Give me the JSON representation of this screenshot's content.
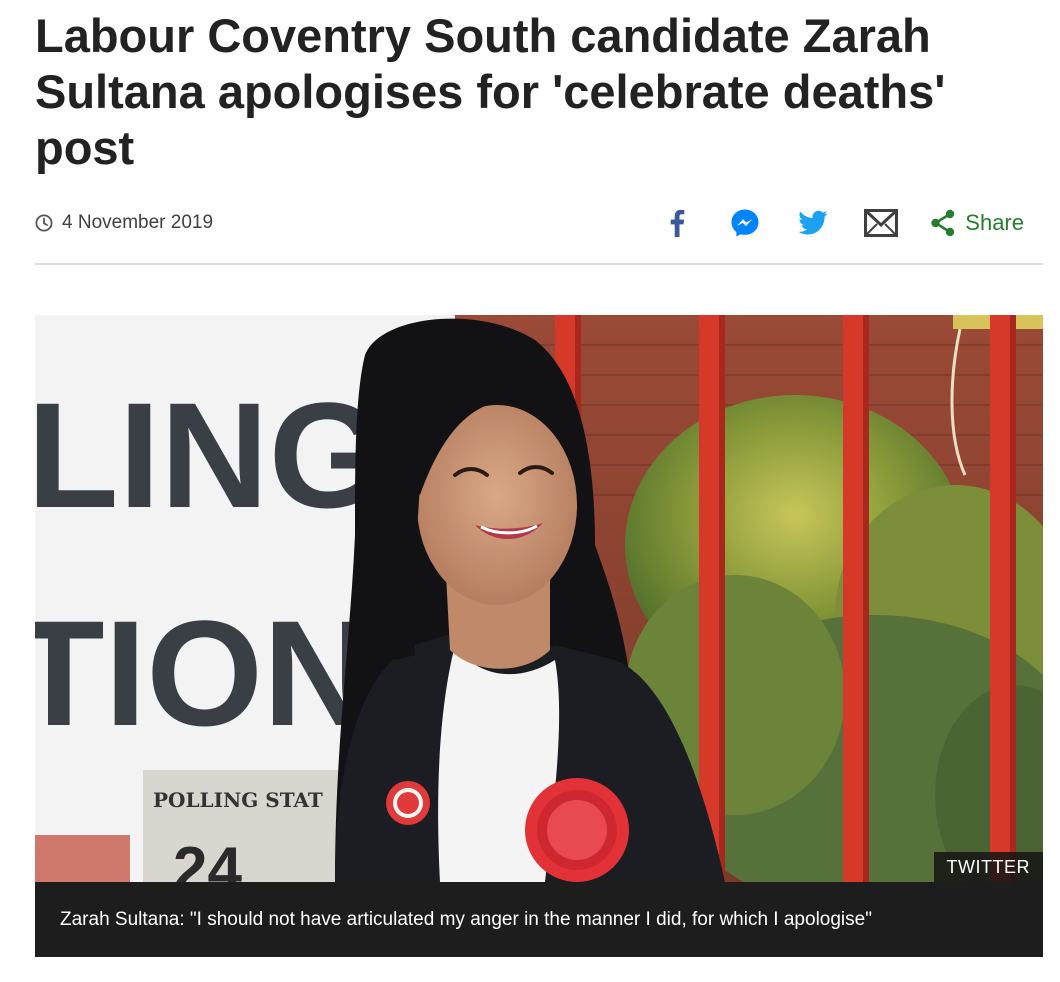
{
  "article": {
    "headline": "Labour Coventry South candidate Zarah Sultana apologises for 'celebrate deaths' post",
    "date": "4 November 2019"
  },
  "share": {
    "label": "Share",
    "icons": [
      "facebook-icon",
      "messenger-icon",
      "twitter-icon",
      "email-icon",
      "share-icon"
    ],
    "colors": {
      "facebook": "#3b5998",
      "messenger": "#0084ff",
      "twitter": "#1da1f2",
      "email": "#404040",
      "share": "#267d2b"
    }
  },
  "image": {
    "credit": "TWITTER",
    "caption": "Zarah Sultana: \"I should not have articulated my anger in the manner I did, for which I apologise\"",
    "sign_large_top": "LING",
    "sign_large_bottom": "TION",
    "sign_small": "POLLING STAT",
    "sign_number": "24"
  }
}
